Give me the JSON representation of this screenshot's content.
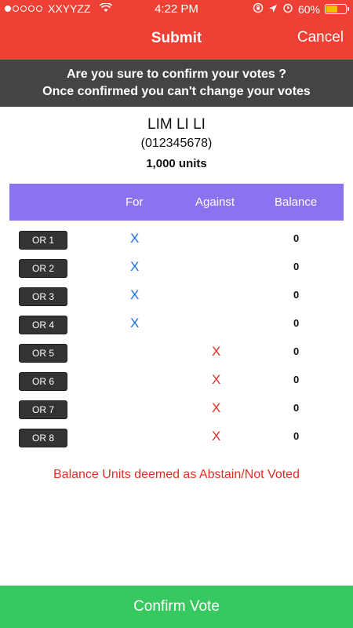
{
  "status_bar": {
    "carrier": "XXYYZZ",
    "time": "4:22 PM",
    "battery": "60%",
    "battery_level": 0.6,
    "icons": [
      "wifi-icon",
      "orientation-lock-icon",
      "location-arrow-icon",
      "alarm-icon",
      "battery-icon"
    ]
  },
  "nav": {
    "title": "Submit",
    "cancel": "Cancel"
  },
  "warning": {
    "line1": "Are you sure to confirm your votes ?",
    "line2": "Once confirmed you can't change your votes"
  },
  "person": {
    "name": "LIM LI LI",
    "id": "(012345678)",
    "units": "1,000 units"
  },
  "table": {
    "columns": [
      "For",
      "Against",
      "Balance"
    ],
    "rows": [
      {
        "label": "OR 1",
        "for": "X",
        "against": "",
        "balance": "0"
      },
      {
        "label": "OR 2",
        "for": "X",
        "against": "",
        "balance": "0"
      },
      {
        "label": "OR 3",
        "for": "X",
        "against": "",
        "balance": "0"
      },
      {
        "label": "OR 4",
        "for": "X",
        "against": "",
        "balance": "0"
      },
      {
        "label": "OR 5",
        "for": "",
        "against": "X",
        "balance": "0"
      },
      {
        "label": "OR 6",
        "for": "",
        "against": "X",
        "balance": "0"
      },
      {
        "label": "OR 7",
        "for": "",
        "against": "X",
        "balance": "0"
      },
      {
        "label": "OR 8",
        "for": "",
        "against": "X",
        "balance": "0"
      }
    ]
  },
  "note": "Balance Units deemed as Abstain/Not Voted",
  "confirm_button": "Confirm Vote",
  "colors": {
    "header": "#ef4035",
    "warning_bg": "#444444",
    "table_header": "#8b72ee",
    "for_mark": "#1f6fe0",
    "against_mark": "#e23228",
    "confirm": "#37c95f"
  }
}
